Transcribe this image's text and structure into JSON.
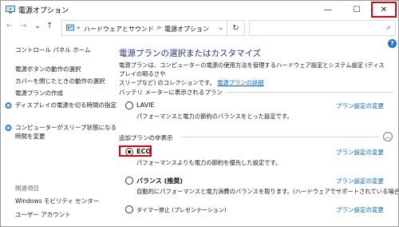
{
  "window": {
    "title": "電源オプション",
    "controls": {
      "minimize": "—",
      "maximize": "☐",
      "close": "✕"
    }
  },
  "address": {
    "back": "←",
    "forward": "→",
    "up": "↑",
    "chevrons": "«",
    "crumbs": [
      "ハードウェアとサウンド",
      "電源オプション"
    ],
    "separator": ">",
    "dropdown": "⌄",
    "refresh": "↻",
    "search_placeholder": ""
  },
  "help": "?",
  "sidebar": {
    "home": "コントロール パネル ホーム",
    "items": [
      "電源ボタンの動作の選択",
      "カバーを閉じたときの動作の選択",
      "電源プランの作成",
      "ディスプレイの電源を切る時間の指定",
      "コンピューターがスリープ状態になる",
      "時間を変更"
    ],
    "related_title": "関連項目",
    "related": [
      "Windows モビリティ センター",
      "ユーザー アカウント"
    ]
  },
  "main": {
    "heading": "電源プランの選択またはカスタマイズ",
    "intro_line1": "電源プランは、コンピューターの電源の使用方法を管理するハードウェア設定とシステム設定 (ディスプレイの明るさや",
    "intro_line2": "スリープなど) のコレクションです。",
    "intro_link": "電源プランの詳細",
    "battery_section": "バッテリ メーターに表示されるプラン",
    "extra_section": "追加プランの非表示",
    "change_label": "プラン設定の変更",
    "plans": [
      {
        "name": "LAVIE",
        "desc": "パフォーマンスと電力の節約のバランスをとった設定です。",
        "selected": false
      },
      {
        "name": "ECO",
        "desc": "パフォーマンスよりも電力の節約を優先した設定です。",
        "selected": true
      },
      {
        "name": "バランス (推奨)",
        "desc": "自動的にパフォーマンスと電力消費のバランスを取ります。(ハードウェアでサポートされている場合)",
        "selected": false
      },
      {
        "name": "タイマー禁止 (プレゼンテーション)",
        "desc": "",
        "selected": false
      }
    ]
  },
  "colors": {
    "heading": "#1e3287",
    "link": "#0066cc",
    "highlight": "#e1000f"
  }
}
